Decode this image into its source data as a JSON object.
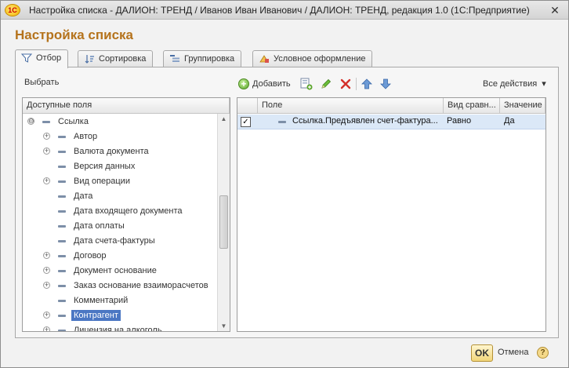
{
  "window": {
    "title": "Настройка списка - ДАЛИОН: ТРЕНД / Иванов Иван Иванович / ДАЛИОН: ТРЕНД, редакция 1.0  (1С:Предприятие)",
    "app_logo": "1С",
    "close_glyph": "✕"
  },
  "form_title": "Настройка списка",
  "tabs": [
    {
      "label": "Отбор",
      "icon": "funnel-icon",
      "active": true
    },
    {
      "label": "Сортировка",
      "icon": "sort-icon",
      "active": false
    },
    {
      "label": "Группировка",
      "icon": "grouping-icon",
      "active": false
    },
    {
      "label": "Условное оформление",
      "icon": "conditional-format-icon",
      "active": false
    }
  ],
  "left_panel": {
    "choose_label": "Выбрать",
    "column_header": "Доступные поля",
    "items": [
      {
        "label": "Ссылка",
        "expander": "⊖",
        "level": 0
      },
      {
        "label": "Автор",
        "expander": "+",
        "level": 1
      },
      {
        "label": "Валюта документа",
        "expander": "+",
        "level": 1
      },
      {
        "label": "Версия данных",
        "expander": "",
        "level": 1
      },
      {
        "label": "Вид операции",
        "expander": "+",
        "level": 1
      },
      {
        "label": "Дата",
        "expander": "",
        "level": 1
      },
      {
        "label": "Дата входящего документа",
        "expander": "",
        "level": 1
      },
      {
        "label": "Дата оплаты",
        "expander": "",
        "level": 1
      },
      {
        "label": "Дата счета-фактуры",
        "expander": "",
        "level": 1
      },
      {
        "label": "Договор",
        "expander": "+",
        "level": 1
      },
      {
        "label": "Документ основание",
        "expander": "+",
        "level": 1
      },
      {
        "label": "Заказ основание взаиморасчетов",
        "expander": "+",
        "level": 1
      },
      {
        "label": "Комментарий",
        "expander": "",
        "level": 1
      },
      {
        "label": "Контрагент",
        "expander": "+",
        "level": 1,
        "selected": true
      },
      {
        "label": "Лицензия на алкоголь",
        "expander": "+",
        "level": 1
      }
    ],
    "scroll_up": "▲",
    "scroll_down": "▼"
  },
  "toolbar": {
    "add_label": "Добавить",
    "add_glyph": "+",
    "all_actions_label": "Все действия",
    "dropdown_glyph": "▾"
  },
  "grid": {
    "columns": [
      "Поле",
      "Вид сравн...",
      "Значение"
    ],
    "rows": [
      {
        "checked": "✓",
        "field": "Ссылка.Предъявлен счет-фактура...",
        "comparison": "Равно",
        "value": "Да"
      }
    ]
  },
  "footer": {
    "ok_label": "OK",
    "cancel_label": "Отмена",
    "help_glyph": "?"
  },
  "colors": {
    "form_title": "#b5731c",
    "selection": "#4b77c3",
    "row_highlight": "#dbe8f7",
    "ok_button": "#f1d57a"
  }
}
